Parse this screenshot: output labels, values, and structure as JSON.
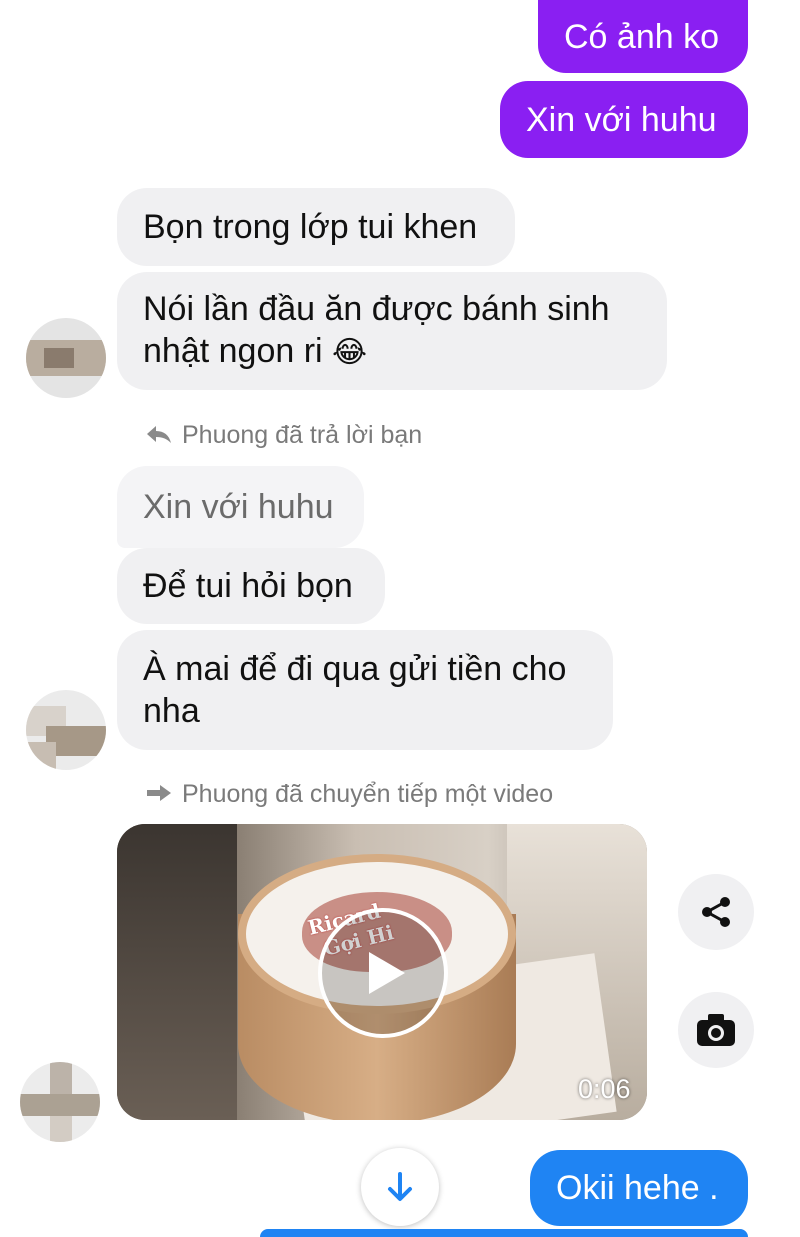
{
  "messages": {
    "sent_1": "Có ảnh ko",
    "sent_2": "Xin với huhu",
    "recv_1": "Bọn trong lớp tui khen",
    "recv_2_line1": "Nói lần đầu ăn được bánh sinh",
    "recv_2_line2": "nhật ngon ri",
    "recv_2_emoji": "😂",
    "reply_quote": "Xin với huhu",
    "recv_3": "Để tui hỏi bọn",
    "recv_4_line1": "À mai để đi qua gửi tiền cho",
    "recv_4_line2": "nha",
    "sent_last": "Okii hehe ."
  },
  "meta": {
    "reply_note": "Phuong đã trả lời bạn",
    "forward_note": "Phuong đã chuyển tiếp một video"
  },
  "video": {
    "duration": "0:06",
    "cake_text_1": "Ricard",
    "cake_text_2": "Gợi Hi"
  },
  "icons": {
    "reply": "reply-arrow-icon",
    "forward": "forward-arrow-icon",
    "share": "share-icon",
    "camera": "camera-icon",
    "play": "play-icon",
    "scroll_down": "arrow-down-icon"
  },
  "colors": {
    "sent_bubble": "#8a1ff2",
    "received_bubble": "#f0f0f2",
    "last_sent_bubble": "#1f84f3"
  }
}
